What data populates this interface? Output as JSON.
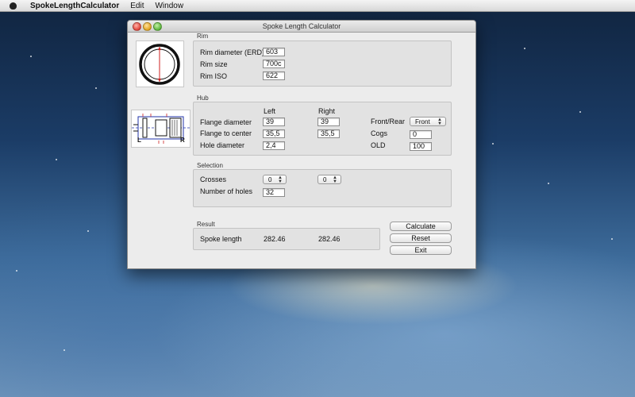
{
  "menubar": {
    "app_name": "SpokeLengthCalculator",
    "items": [
      "Edit",
      "Window"
    ]
  },
  "window": {
    "title": "Spoke Length Calculator"
  },
  "rim": {
    "section_title": "Rim",
    "erd_label": "Rim diameter (ERD)",
    "erd_value": "603",
    "size_label": "Rim size",
    "size_value": "700c",
    "iso_label": "Rim ISO",
    "iso_value": "622"
  },
  "hub": {
    "section_title": "Hub",
    "left_header": "Left",
    "right_header": "Right",
    "flange_diameter_label": "Flange diameter",
    "flange_diameter_left": "39",
    "flange_diameter_right": "39",
    "flange_to_center_label": "Flange to center",
    "flange_to_center_left": "35,5",
    "flange_to_center_right": "35,5",
    "hole_diameter_label": "Hole diameter",
    "hole_diameter_value": "2,4",
    "front_rear_label": "Front/Rear",
    "front_rear_value": "Front",
    "cogs_label": "Cogs",
    "cogs_value": "0",
    "old_label": "OLD",
    "old_value": "100",
    "diagram_left_letter": "L",
    "diagram_right_letter": "R"
  },
  "selection": {
    "section_title": "Selection",
    "crosses_label": "Crosses",
    "crosses_left": "0",
    "crosses_right": "0",
    "holes_label": "Number of holes",
    "holes_value": "32"
  },
  "result": {
    "section_title": "Result",
    "spoke_length_label": "Spoke length",
    "left_value": "282.46",
    "right_value": "282.46"
  },
  "buttons": {
    "calculate": "Calculate",
    "reset": "Reset",
    "exit": "Exit"
  },
  "colors": {
    "rim_diagram_red": "#cc2222",
    "hub_diagram_blue": "#2233aa"
  }
}
